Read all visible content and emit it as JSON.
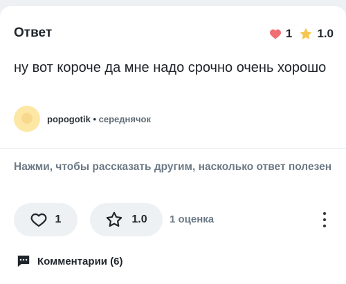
{
  "answer_card": {
    "title": "Ответ",
    "likes": "1",
    "rating": "1.0",
    "text": "ну вот короче да мне надо срочно очень хорошо",
    "author": {
      "name": "popogotik",
      "separator": "•",
      "rank": "середнячок"
    }
  },
  "feedback": {
    "prompt": "Нажми, чтобы рассказать другим, насколько ответ полезен",
    "like_button_value": "1",
    "rate_button_value": "1.0",
    "ratings_count": "1 оценка"
  },
  "comments": {
    "label": "Комментарии (6)"
  },
  "colors": {
    "heart": "#ef6f72",
    "star": "#f6c64f",
    "muted_text": "#6c7a86",
    "button_bg": "#eef1f3"
  },
  "icons": [
    "heart-icon",
    "star-icon",
    "heart-outline-icon",
    "star-outline-icon",
    "more-icon",
    "comment-icon"
  ]
}
